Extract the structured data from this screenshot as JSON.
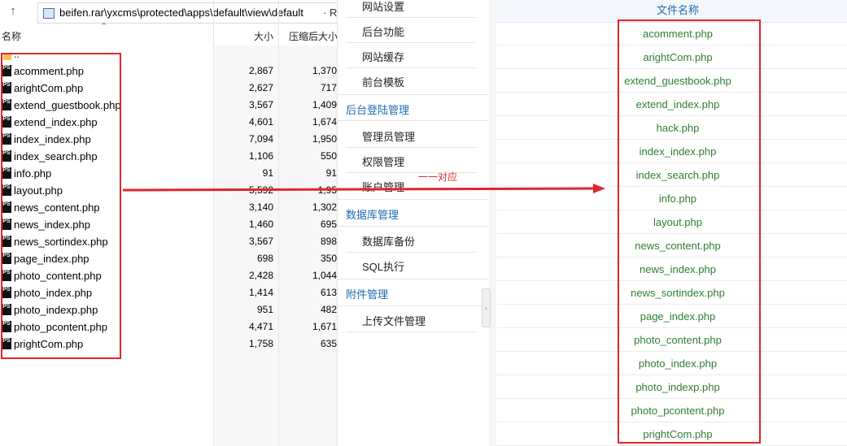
{
  "left_pane": {
    "address": "beifen.rar\\yxcms\\protected\\apps\\default\\view\\default",
    "address_overflow": "· RA",
    "columns": {
      "name": "名称",
      "size": "大小",
      "packed": "压缩后大小"
    },
    "parent_dir": "..",
    "files": [
      {
        "name": "acomment.php",
        "size": "2,867",
        "packed": "1,370"
      },
      {
        "name": "arightCom.php",
        "size": "2,627",
        "packed": "717"
      },
      {
        "name": "extend_guestbook.php",
        "size": "3,567",
        "packed": "1,409"
      },
      {
        "name": "extend_index.php",
        "size": "4,601",
        "packed": "1,674"
      },
      {
        "name": "index_index.php",
        "size": "7,094",
        "packed": "1,950"
      },
      {
        "name": "index_search.php",
        "size": "1,106",
        "packed": "550"
      },
      {
        "name": "info.php",
        "size": "91",
        "packed": "91"
      },
      {
        "name": "layout.php",
        "size": "5,592",
        "packed": "1,95"
      },
      {
        "name": "news_content.php",
        "size": "3,140",
        "packed": "1,302"
      },
      {
        "name": "news_index.php",
        "size": "1,460",
        "packed": "695"
      },
      {
        "name": "news_sortindex.php",
        "size": "3,567",
        "packed": "898"
      },
      {
        "name": "page_index.php",
        "size": "698",
        "packed": "350"
      },
      {
        "name": "photo_content.php",
        "size": "2,428",
        "packed": "1,044"
      },
      {
        "name": "photo_index.php",
        "size": "1,414",
        "packed": "613"
      },
      {
        "name": "photo_indexp.php",
        "size": "951",
        "packed": "482"
      },
      {
        "name": "photo_pcontent.php",
        "size": "4,471",
        "packed": "1,671"
      },
      {
        "name": "prightCom.php",
        "size": "1,758",
        "packed": "635"
      }
    ],
    "file_icon_label": "PS"
  },
  "menu": {
    "items": {
      "site_settings": "网站设置",
      "backend_functions": "后台功能",
      "site_cache": "网站缓存",
      "frontend_templates": "前台模板",
      "group_login": "后台登陆管理",
      "admin_manage": "管理员管理",
      "permission_manage": "权限管理",
      "account_manage": "账户管理",
      "group_database": "数据库管理",
      "db_backup": "数据库备份",
      "sql_exec": "SQL执行",
      "group_attachments": "附件管理",
      "upload_manage": "上传文件管理"
    }
  },
  "right_pane": {
    "header": "文件名称",
    "files": [
      "acomment.php",
      "arightCom.php",
      "extend_guestbook.php",
      "extend_index.php",
      "hack.php",
      "index_index.php",
      "index_search.php",
      "info.php",
      "layout.php",
      "news_content.php",
      "news_index.php",
      "news_sortindex.php",
      "page_index.php",
      "photo_content.php",
      "photo_index.php",
      "photo_indexp.php",
      "photo_pcontent.php",
      "prightCom.php"
    ]
  },
  "annotation": {
    "label": "一一对应",
    "color": "#e0262b"
  },
  "colors": {
    "link_blue": "#1e6ab3",
    "file_green": "#2e7d32",
    "highlight_red": "#e0262b"
  }
}
